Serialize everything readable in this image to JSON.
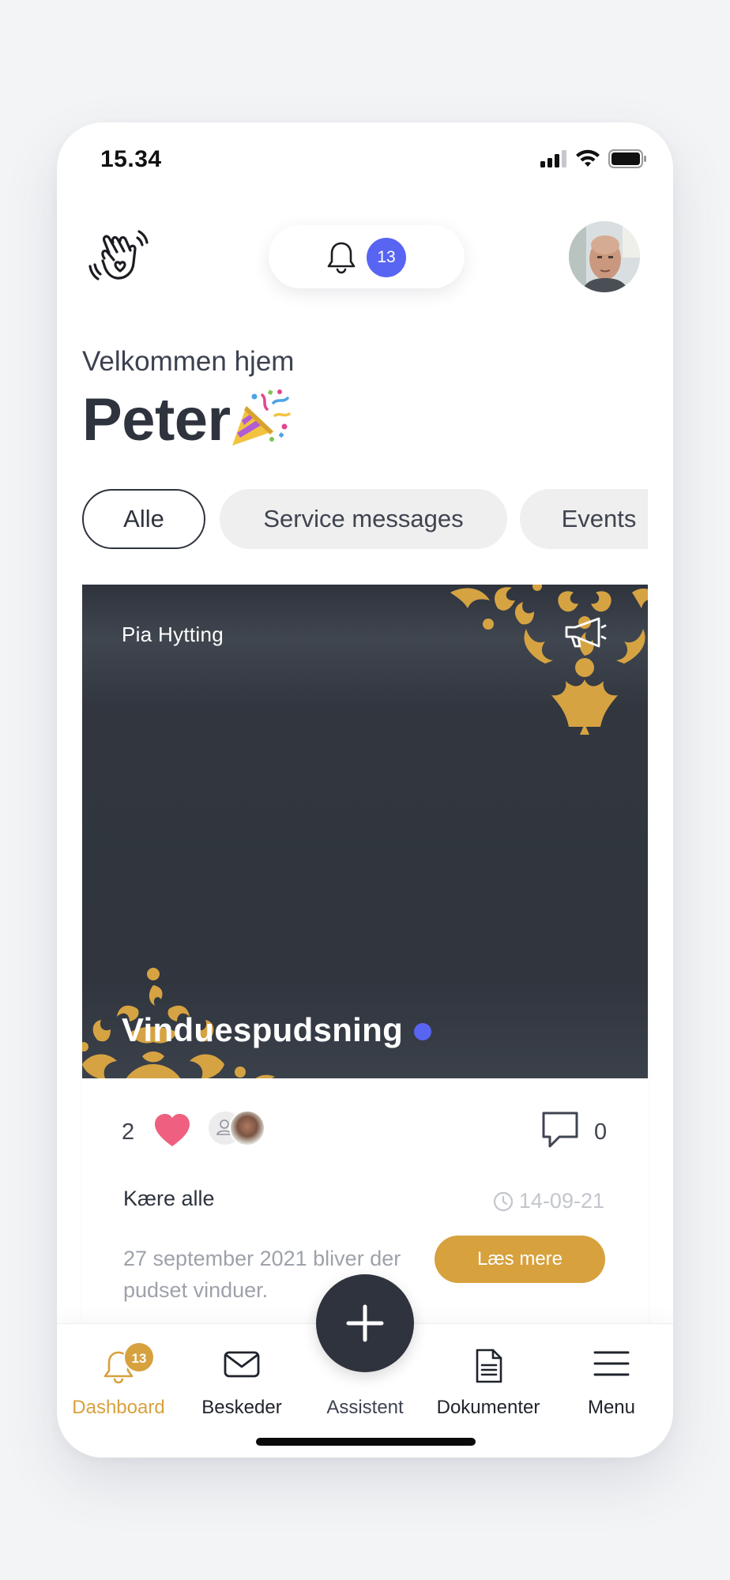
{
  "status_bar": {
    "time": "15.34"
  },
  "header": {
    "notification_count": "13"
  },
  "greeting": {
    "welcome": "Velkommen hjem",
    "name": "Peter"
  },
  "filters": [
    {
      "label": "Alle",
      "active": true
    },
    {
      "label": "Service messages",
      "active": false
    },
    {
      "label": "Events",
      "active": false
    }
  ],
  "post": {
    "author": "Pia Hytting",
    "title": "Vinduespudsning",
    "like_count": "2",
    "comment_count": "0",
    "greeting": "Kære alle",
    "date": "14-09-21",
    "excerpt": "27 september 2021 bliver der pudset vinduer.",
    "read_more_label": "Læs mere"
  },
  "tabbar": {
    "items": [
      {
        "label": "Dashboard",
        "icon": "bell-icon",
        "active": true,
        "badge": "13"
      },
      {
        "label": "Beskeder",
        "icon": "envelope-icon",
        "active": false
      },
      {
        "label": "Assistent",
        "icon": "plus-icon",
        "active": false
      },
      {
        "label": "Dokumenter",
        "icon": "document-icon",
        "active": false
      },
      {
        "label": "Menu",
        "icon": "hamburger-menu-icon",
        "active": false
      }
    ]
  },
  "colors": {
    "accent_gold": "#d7a13e",
    "accent_blue": "#5865f2",
    "dark": "#2e333d",
    "like_pink": "#ef5f7f"
  }
}
